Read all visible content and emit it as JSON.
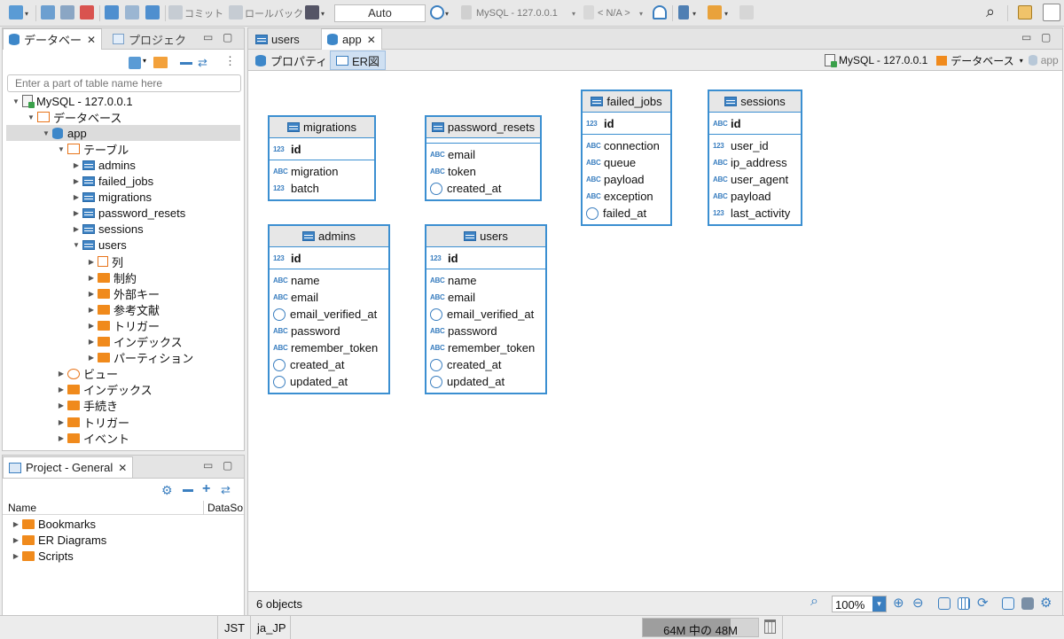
{
  "toolbar": {
    "commit_label": "コミット",
    "rollback_label": "ロールバック",
    "tx_mode": "Auto",
    "connection_label": "MySQL - 127.0.0.1",
    "schema_label": "< N/A >"
  },
  "db_navigator": {
    "tab_label": "データベー",
    "projects_tab_label": "プロジェク",
    "filter_placeholder": "Enter a part of table name here",
    "tree": [
      {
        "label": "MySQL - 127.0.0.1",
        "icon": "server-icon",
        "depth": 0,
        "expanded": true
      },
      {
        "label": "データベース",
        "icon": "databases-folder-icon",
        "depth": 1,
        "expanded": true
      },
      {
        "label": "app",
        "icon": "database-icon",
        "depth": 2,
        "expanded": true,
        "selected": true
      },
      {
        "label": "テーブル",
        "icon": "tables-folder-icon",
        "depth": 3,
        "expanded": true
      },
      {
        "label": "admins",
        "icon": "table-icon",
        "depth": 4,
        "expanded": false
      },
      {
        "label": "failed_jobs",
        "icon": "table-icon",
        "depth": 4,
        "expanded": false
      },
      {
        "label": "migrations",
        "icon": "table-icon",
        "depth": 4,
        "expanded": false
      },
      {
        "label": "password_resets",
        "icon": "table-icon",
        "depth": 4,
        "expanded": false
      },
      {
        "label": "sessions",
        "icon": "table-icon",
        "depth": 4,
        "expanded": false
      },
      {
        "label": "users",
        "icon": "table-icon",
        "depth": 4,
        "expanded": true
      },
      {
        "label": "列",
        "icon": "columns-icon",
        "depth": 5,
        "expanded": false
      },
      {
        "label": "制約",
        "icon": "constraints-icon",
        "depth": 5,
        "expanded": false
      },
      {
        "label": "外部キー",
        "icon": "folder-icon",
        "depth": 5,
        "expanded": false
      },
      {
        "label": "参考文献",
        "icon": "folder-icon",
        "depth": 5,
        "expanded": false
      },
      {
        "label": "トリガー",
        "icon": "folder-icon",
        "depth": 5,
        "expanded": false
      },
      {
        "label": "インデックス",
        "icon": "folder-icon",
        "depth": 5,
        "expanded": false
      },
      {
        "label": "パーティション",
        "icon": "folder-icon",
        "depth": 5,
        "expanded": false
      },
      {
        "label": "ビュー",
        "icon": "view-icon",
        "depth": 3,
        "expanded": false
      },
      {
        "label": "インデックス",
        "icon": "folder-icon",
        "depth": 3,
        "expanded": false
      },
      {
        "label": "手続き",
        "icon": "folder-icon",
        "depth": 3,
        "expanded": false
      },
      {
        "label": "トリガー",
        "icon": "folder-icon",
        "depth": 3,
        "expanded": false
      },
      {
        "label": "イベント",
        "icon": "folder-icon",
        "depth": 3,
        "expanded": false
      }
    ]
  },
  "project_panel": {
    "title": "Project - General",
    "col_name": "Name",
    "col_datasource": "DataSo",
    "items": [
      {
        "label": "Bookmarks",
        "icon": "bookmarks-folder-icon"
      },
      {
        "label": "ER Diagrams",
        "icon": "er-diagrams-folder-icon"
      },
      {
        "label": "Scripts",
        "icon": "scripts-folder-icon"
      }
    ]
  },
  "editor": {
    "tabs": [
      {
        "label": "users",
        "active": false
      },
      {
        "label": "app",
        "active": true
      }
    ],
    "subtabs": [
      {
        "label": "プロパティ",
        "active": false
      },
      {
        "label": "ER図",
        "active": true
      }
    ],
    "breadcrumb": {
      "connection": "MySQL - 127.0.0.1",
      "databases": "データベース",
      "schema": "app"
    }
  },
  "er_diagram": {
    "entities": [
      {
        "name": "migrations",
        "key": [
          {
            "type": "123",
            "name": "id"
          }
        ],
        "columns": [
          {
            "type": "ABC",
            "name": "migration"
          },
          {
            "type": "123",
            "name": "batch"
          }
        ]
      },
      {
        "name": "password_resets",
        "key": [],
        "columns": [
          {
            "type": "ABC",
            "name": "email"
          },
          {
            "type": "ABC",
            "name": "token"
          },
          {
            "type": "clock",
            "name": "created_at"
          }
        ]
      },
      {
        "name": "failed_jobs",
        "key": [
          {
            "type": "123",
            "name": "id"
          }
        ],
        "columns": [
          {
            "type": "ABC",
            "name": "connection"
          },
          {
            "type": "ABC",
            "name": "queue"
          },
          {
            "type": "ABC",
            "name": "payload"
          },
          {
            "type": "ABC",
            "name": "exception"
          },
          {
            "type": "clock",
            "name": "failed_at"
          }
        ]
      },
      {
        "name": "sessions",
        "key": [
          {
            "type": "ABC",
            "name": "id"
          }
        ],
        "columns": [
          {
            "type": "123",
            "name": "user_id"
          },
          {
            "type": "ABC",
            "name": "ip_address"
          },
          {
            "type": "ABC",
            "name": "user_agent"
          },
          {
            "type": "ABC",
            "name": "payload"
          },
          {
            "type": "123",
            "name": "last_activity"
          }
        ]
      },
      {
        "name": "admins",
        "key": [
          {
            "type": "123",
            "name": "id"
          }
        ],
        "columns": [
          {
            "type": "ABC",
            "name": "name"
          },
          {
            "type": "ABC",
            "name": "email"
          },
          {
            "type": "clock",
            "name": "email_verified_at"
          },
          {
            "type": "ABC",
            "name": "password"
          },
          {
            "type": "ABC",
            "name": "remember_token"
          },
          {
            "type": "clock",
            "name": "created_at"
          },
          {
            "type": "clock",
            "name": "updated_at"
          }
        ]
      },
      {
        "name": "users",
        "key": [
          {
            "type": "123",
            "name": "id"
          }
        ],
        "columns": [
          {
            "type": "ABC",
            "name": "name"
          },
          {
            "type": "ABC",
            "name": "email"
          },
          {
            "type": "clock",
            "name": "email_verified_at"
          },
          {
            "type": "ABC",
            "name": "password"
          },
          {
            "type": "ABC",
            "name": "remember_token"
          },
          {
            "type": "clock",
            "name": "created_at"
          },
          {
            "type": "clock",
            "name": "updated_at"
          }
        ]
      }
    ]
  },
  "er_status": {
    "objects_count": "6 objects",
    "zoom": "100%"
  },
  "status_bar": {
    "timezone": "JST",
    "locale": "ja_JP",
    "memory": "64M 中の 48M"
  },
  "colors": {
    "entity_border": "#3b8fd1",
    "folder": "#f08a1c",
    "selection": "#dcdcdc"
  }
}
